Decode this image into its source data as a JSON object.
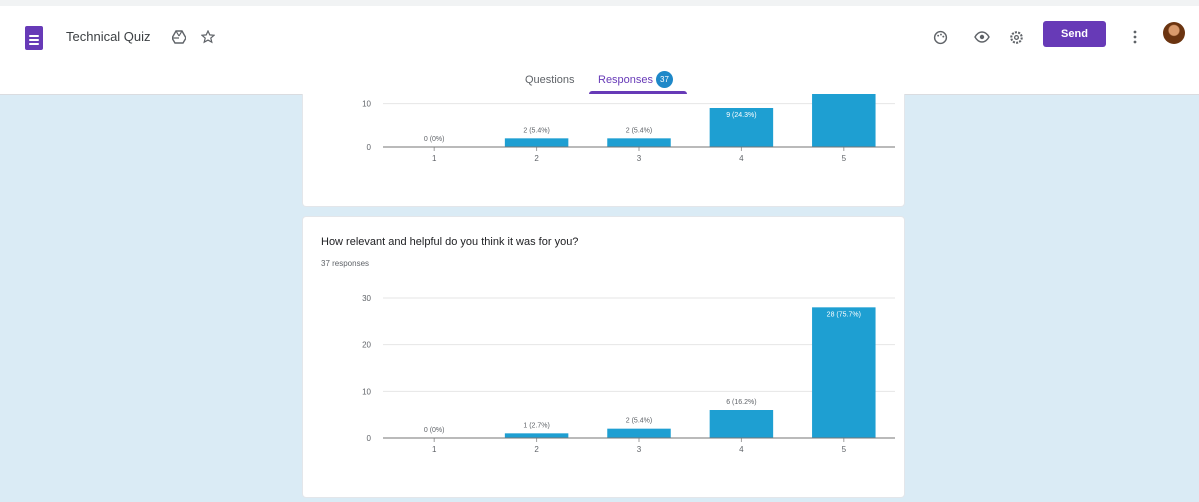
{
  "header": {
    "title": "Technical Quiz",
    "send_label": "Send"
  },
  "icons": {
    "drive": "drive-icon",
    "star": "star-icon",
    "palette": "palette-icon",
    "preview": "eye-icon",
    "settings": "gear-icon",
    "more": "more-vert-icon",
    "avatar": "avatar"
  },
  "tabs": [
    {
      "label": "Questions"
    },
    {
      "label": "Responses"
    }
  ],
  "responses_count": "37",
  "colors": {
    "accent": "#673ab7",
    "bar": "#1e9fd2",
    "background": "#daebf5"
  },
  "cards": [
    {
      "title": "",
      "subtitle": ""
    },
    {
      "title": "How relevant and helpful do you think it was for you?",
      "subtitle": "37 responses"
    }
  ],
  "chart_data": [
    {
      "type": "bar",
      "categories": [
        "1",
        "2",
        "3",
        "4",
        "5"
      ],
      "values": [
        0,
        2,
        2,
        9,
        14
      ],
      "data_labels": [
        "0 (0%)",
        "2 (5.4%)",
        "2 (5.4%)",
        "9 (24.3%)",
        ""
      ],
      "yticks": [
        0,
        10
      ],
      "ylim": [
        0,
        12
      ]
    },
    {
      "type": "bar",
      "categories": [
        "1",
        "2",
        "3",
        "4",
        "5"
      ],
      "values": [
        0,
        1,
        2,
        6,
        28
      ],
      "data_labels": [
        "0 (0%)",
        "1 (2.7%)",
        "2 (5.4%)",
        "6 (16.2%)",
        "28 (75.7%)"
      ],
      "yticks": [
        0,
        10,
        20,
        30
      ],
      "ylim": [
        0,
        30
      ]
    }
  ]
}
